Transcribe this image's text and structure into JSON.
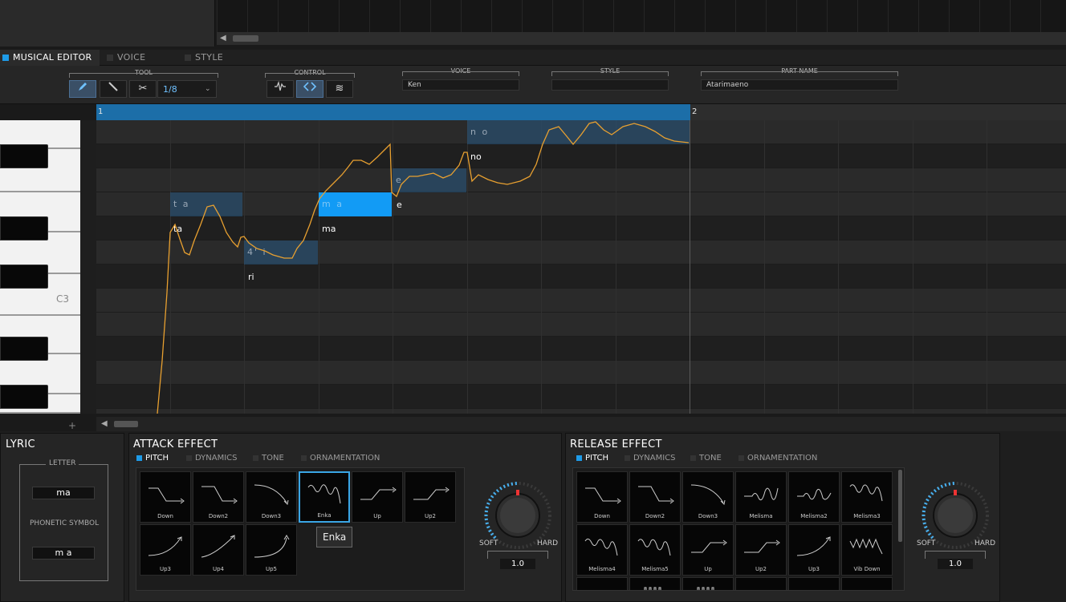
{
  "tabs": [
    {
      "label": "MUSICAL EDITOR",
      "active": true
    },
    {
      "label": "VOICE",
      "active": false
    },
    {
      "label": "STYLE",
      "active": false
    }
  ],
  "toolbar": {
    "tool_label": "TOOL",
    "quantize": "1/8",
    "control_label": "CONTROL",
    "voice_label": "VOICE",
    "voice_value": "Ken",
    "style_label": "STYLE",
    "style_value": "",
    "partname_label": "PART NAME",
    "partname_value": "Atarimaeno"
  },
  "ruler": {
    "bar1": "1",
    "bar2": "2"
  },
  "piano": {
    "c3_label": "C3"
  },
  "notes": [
    {
      "phoneme": "t a",
      "lyric": "ta"
    },
    {
      "phoneme": "4' i",
      "lyric": "ri"
    },
    {
      "phoneme": "m a",
      "lyric": "ma"
    },
    {
      "phoneme": "e",
      "lyric": "e"
    },
    {
      "phoneme": "n o",
      "lyric": "no"
    }
  ],
  "lyric_panel": {
    "title": "LYRIC",
    "letter_label": "LETTER",
    "letter_value": "ma",
    "phonetic_label": "PHONETIC SYMBOL",
    "phonetic_value": "m a"
  },
  "attack": {
    "title": "ATTACK EFFECT",
    "subtabs": [
      "PITCH",
      "DYNAMICS",
      "TONE",
      "ORNAMENTATION"
    ],
    "tiles": [
      "Down",
      "Down2",
      "Down3",
      "Enka",
      "Up",
      "Up2",
      "Up3",
      "Up4",
      "Up5"
    ],
    "tooltip": "Enka",
    "soft": "SOFT",
    "hard": "HARD",
    "value": "1.0"
  },
  "release": {
    "title": "RELEASE EFFECT",
    "subtabs": [
      "PITCH",
      "DYNAMICS",
      "TONE",
      "ORNAMENTATION"
    ],
    "tiles": [
      "Down",
      "Down2",
      "Down3",
      "Melisma",
      "Melisma2",
      "Melisma3",
      "Melisma4",
      "Melisma5",
      "Up",
      "Up2",
      "Up3",
      "Vib Down"
    ],
    "soft": "SOFT",
    "hard": "HARD",
    "value": "1.0"
  },
  "colors": {
    "accent": "#1e9be8",
    "pitch_curve": "#e8a030",
    "selected_note": "#129bf5"
  }
}
